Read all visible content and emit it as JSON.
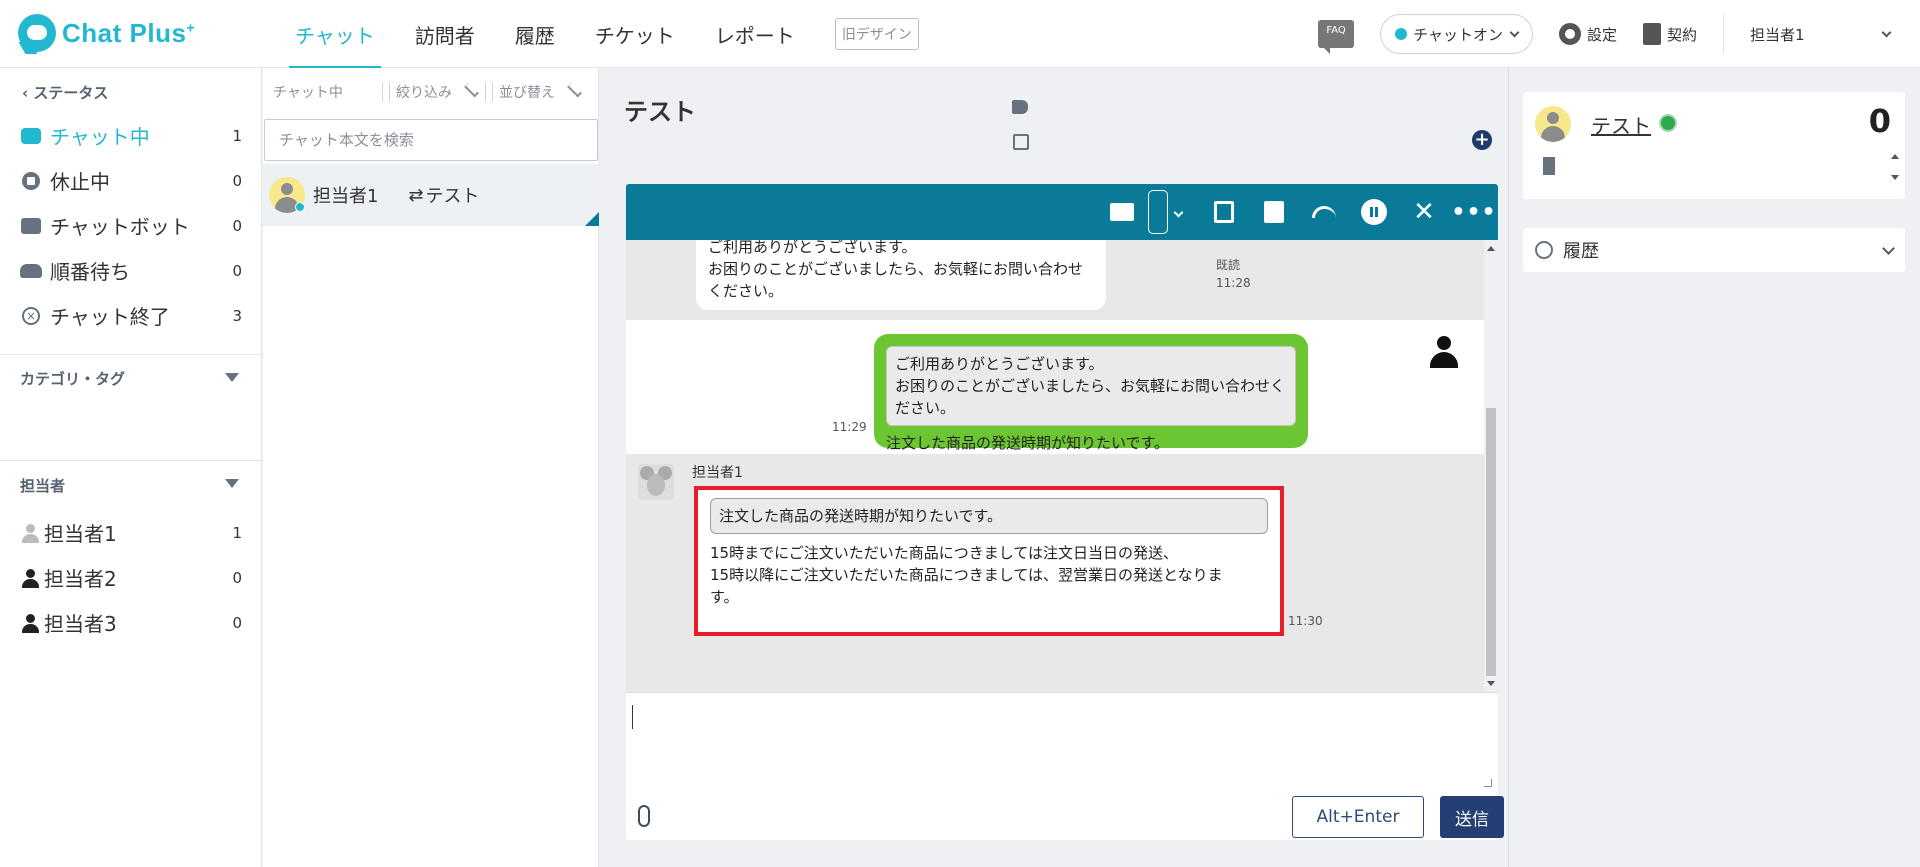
{
  "app": {
    "logo_text": "Chat Plus",
    "logo_sup": "+"
  },
  "nav": {
    "items": [
      {
        "label": "チャット",
        "active": true
      },
      {
        "label": "訪問者",
        "active": false
      },
      {
        "label": "履歴",
        "active": false
      },
      {
        "label": "チケット",
        "active": false
      },
      {
        "label": "レポート",
        "active": false
      }
    ],
    "old_design": "旧デザイン"
  },
  "header_right": {
    "faq": "FAQ",
    "status": "チャットオン",
    "settings": "設定",
    "contract": "契約",
    "user": "担当者1"
  },
  "sidebar": {
    "back_label": "ステータス",
    "statuses": [
      {
        "label": "チャット中",
        "count": "1",
        "icon": "chat-icon",
        "active": true
      },
      {
        "label": "休止中",
        "count": "0",
        "icon": "pause-circle-icon",
        "active": false
      },
      {
        "label": "チャットボット",
        "count": "0",
        "icon": "bot-icon",
        "active": false
      },
      {
        "label": "順番待ち",
        "count": "0",
        "icon": "queue-icon",
        "active": false
      },
      {
        "label": "チャット終了",
        "count": "3",
        "icon": "close-circle-icon",
        "active": false
      }
    ],
    "category_title": "カテゴリ・タグ",
    "agents_title": "担当者",
    "agents": [
      {
        "label": "担当者1",
        "count": "1",
        "avatar": "mouse"
      },
      {
        "label": "担当者2",
        "count": "0",
        "avatar": "person"
      },
      {
        "label": "担当者3",
        "count": "0",
        "avatar": "person"
      }
    ]
  },
  "chatlist": {
    "header": "チャット中",
    "filter": "絞り込み",
    "sort": "並び替え",
    "search_placeholder": "チャット本文を検索",
    "item": {
      "agent": "担当者1",
      "arrows": "⇄",
      "visitor": "テスト"
    }
  },
  "chat": {
    "title": "テスト",
    "msg1": {
      "line1": "ご利用ありがとうございます。",
      "line2": "お困りのことがございましたら、お気軽にお問い合わせください。",
      "read": "既読",
      "time": "11:28"
    },
    "msg2": {
      "quote_line1": "ご利用ありがとうございます。",
      "quote_line2": "お困りのことがございましたら、お気軽にお問い合わせください。",
      "text": "注文した商品の発送時期が知りたいです。",
      "time": "11:29"
    },
    "msg3": {
      "agent": "担当者1",
      "quote": "注文した商品の発送時期が知りたいです。",
      "line1": "15時までにご注文いただいた商品につきましては注文日当日の発送、",
      "line2": "15時以降にご注文いただいた商品につきましては、翌営業日の発送となりま",
      "line3": "す。",
      "time": "11:30"
    },
    "alt_enter": "Alt+Enter",
    "send": "送信"
  },
  "visitor": {
    "name": "テスト",
    "count": "0",
    "history_label": "履歴"
  }
}
